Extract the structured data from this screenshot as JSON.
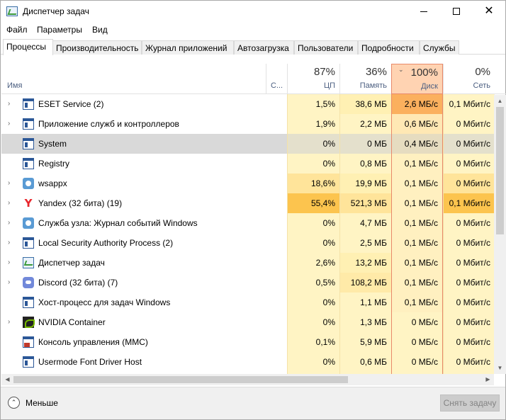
{
  "window": {
    "title": "Диспетчер задач",
    "minimize": "—",
    "maximize": "☐",
    "close": "✕"
  },
  "menu": [
    "Файл",
    "Параметры",
    "Вид"
  ],
  "tabs": [
    "Процессы",
    "Производительность",
    "Журнал приложений",
    "Автозагрузка",
    "Пользователи",
    "Подробности",
    "Службы"
  ],
  "active_tab": 0,
  "columns": {
    "name": "Имя",
    "status": "С...",
    "cpu": {
      "pct": "87%",
      "label": "ЦП"
    },
    "memory": {
      "pct": "36%",
      "label": "Память"
    },
    "disk": {
      "pct": "100%",
      "label": "Диск",
      "sort": "⌄"
    },
    "network": {
      "pct": "0%",
      "label": "Сеть"
    }
  },
  "rows": [
    {
      "name": "ESET Service (2)",
      "icon": "window-icon",
      "expand": "›",
      "cpu": "1,5%",
      "mem": "38,6 МБ",
      "disk": "2,6 МБ/с",
      "net": "0,1 Мбит/с",
      "cpu_color": "#fff4c4",
      "mem_color": "#fff0b3",
      "disk_color": "#fbb05e"
    },
    {
      "name": "Приложение служб и контроллеров",
      "icon": "window-icon",
      "expand": "›",
      "cpu": "1,9%",
      "mem": "2,2 МБ",
      "disk": "0,6 МБ/с",
      "net": "0 Мбит/с",
      "cpu_color": "#fff4c4",
      "mem_color": "#fff4c4",
      "disk_color": "#ffe8b4"
    },
    {
      "name": "System",
      "icon": "window-icon",
      "expand": "",
      "cpu": "0%",
      "mem": "0 МБ",
      "disk": "0,4 МБ/с",
      "net": "0 Мбит/с",
      "cpu_color": "#e4e0cc",
      "mem_color": "#e4e0cc",
      "disk_color": "#e6dcc0",
      "selected": true
    },
    {
      "name": "Registry",
      "icon": "window-icon",
      "expand": "",
      "cpu": "0%",
      "mem": "0,8 МБ",
      "disk": "0,1 МБ/с",
      "net": "0 Мбит/с",
      "cpu_color": "#fff4c4",
      "mem_color": "#fff4c4",
      "disk_color": "#fff0c0"
    },
    {
      "name": "wsappx",
      "icon": "gear-icon",
      "expand": "›",
      "cpu": "18,6%",
      "mem": "19,9 МБ",
      "disk": "0,1 МБ/с",
      "net": "0 Мбит/с",
      "cpu_color": "#ffe49a",
      "mem_color": "#fff0b3",
      "disk_color": "#fff0c0"
    },
    {
      "name": "Yandex (32 бита) (19)",
      "icon": "yandex-icon",
      "expand": "›",
      "cpu": "55,4%",
      "mem": "521,3 МБ",
      "disk": "0,1 МБ/с",
      "net": "0,1 Мбит/с",
      "cpu_color": "#fcc44e",
      "mem_color": "#ffe49a",
      "disk_color": "#fff0c0"
    },
    {
      "name": "Служба узла: Журнал событий Windows",
      "icon": "gear-icon",
      "expand": "›",
      "cpu": "0%",
      "mem": "4,7 МБ",
      "disk": "0,1 МБ/с",
      "net": "0 Мбит/с",
      "cpu_color": "#fff4c4",
      "mem_color": "#fff4c4",
      "disk_color": "#fff0c0"
    },
    {
      "name": "Local Security Authority Process (2)",
      "icon": "window-icon",
      "expand": "›",
      "cpu": "0%",
      "mem": "2,5 МБ",
      "disk": "0,1 МБ/с",
      "net": "0 Мбит/с",
      "cpu_color": "#fff4c4",
      "mem_color": "#fff4c4",
      "disk_color": "#fff0c0"
    },
    {
      "name": "Диспетчер задач",
      "icon": "taskmgr-icon",
      "expand": "›",
      "cpu": "2,6%",
      "mem": "13,2 МБ",
      "disk": "0,1 МБ/с",
      "net": "0 Мбит/с",
      "cpu_color": "#fff4c4",
      "mem_color": "#fff0b3",
      "disk_color": "#fff0c0"
    },
    {
      "name": "Discord (32 бита) (7)",
      "icon": "discord-icon",
      "expand": "›",
      "cpu": "0,5%",
      "mem": "108,2 МБ",
      "disk": "0,1 МБ/с",
      "net": "0 Мбит/с",
      "cpu_color": "#fff4c4",
      "mem_color": "#ffeaa8",
      "disk_color": "#fff0c0"
    },
    {
      "name": "Хост-процесс для задач Windows",
      "icon": "window-icon",
      "expand": "",
      "cpu": "0%",
      "mem": "1,1 МБ",
      "disk": "0,1 МБ/с",
      "net": "0 Мбит/с",
      "cpu_color": "#fff4c4",
      "mem_color": "#fff4c4",
      "disk_color": "#fff0c0"
    },
    {
      "name": "NVIDIA Container",
      "icon": "nvidia-icon",
      "expand": "›",
      "cpu": "0%",
      "mem": "1,3 МБ",
      "disk": "0 МБ/с",
      "net": "0 Мбит/с",
      "cpu_color": "#fff4c4",
      "mem_color": "#fff4c4",
      "disk_color": "#fff4c4"
    },
    {
      "name": "Консоль управления (MMC)",
      "icon": "mmc-icon",
      "expand": "",
      "cpu": "0,1%",
      "mem": "5,9 МБ",
      "disk": "0 МБ/с",
      "net": "0 Мбит/с",
      "cpu_color": "#fff4c4",
      "mem_color": "#fff4c4",
      "disk_color": "#fff4c4"
    },
    {
      "name": "Usermode Font Driver Host",
      "icon": "window-icon",
      "expand": "",
      "cpu": "0%",
      "mem": "0,6 МБ",
      "disk": "0 МБ/с",
      "net": "0 Мбит/с",
      "cpu_color": "#fff4c4",
      "mem_color": "#fff4c4",
      "disk_color": "#fff4c4"
    },
    {
      "name": "",
      "icon": "window-icon",
      "expand": "",
      "cpu": "",
      "mem": "",
      "disk": "",
      "net": "",
      "cpu_color": "#fff4c4",
      "mem_color": "#fff4c4",
      "disk_color": "#fff4c4"
    }
  ],
  "scroll": {
    "up": "▲",
    "down": "▼",
    "left": "◀",
    "right": "▶"
  },
  "footer": {
    "less_icon": "⌃",
    "less_label": "Меньше",
    "end_task": "Снять задачу"
  }
}
